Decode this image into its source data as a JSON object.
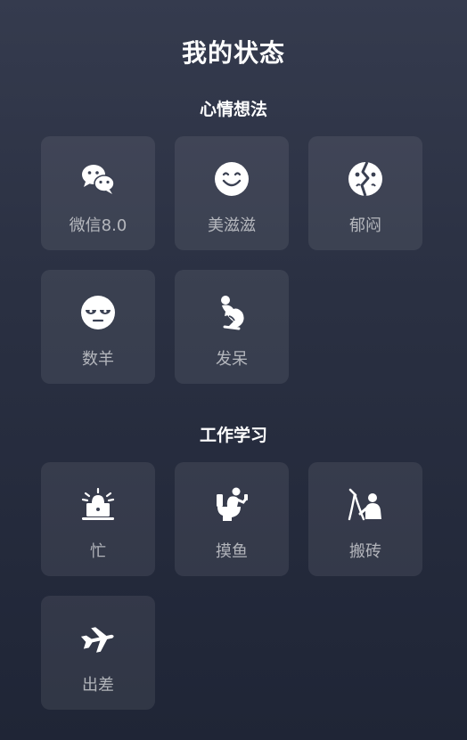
{
  "page": {
    "title": "我的状态"
  },
  "sections": [
    {
      "title": "心情想法",
      "items": [
        {
          "label": "微信8.0",
          "icon": "wechat-icon"
        },
        {
          "label": "美滋滋",
          "icon": "smile-icon"
        },
        {
          "label": "郁闷",
          "icon": "broken-face-icon"
        },
        {
          "label": "数羊",
          "icon": "sleepy-face-icon"
        },
        {
          "label": "发呆",
          "icon": "thinker-icon"
        }
      ]
    },
    {
      "title": "工作学习",
      "items": [
        {
          "label": "忙",
          "icon": "alarm-laptop-icon"
        },
        {
          "label": "摸鱼",
          "icon": "toilet-phone-icon"
        },
        {
          "label": "搬砖",
          "icon": "worker-icon"
        },
        {
          "label": "出差",
          "icon": "airplane-icon"
        }
      ]
    }
  ],
  "colors": {
    "background_top": "#353b4e",
    "background_bottom": "#1f2536",
    "tile": "#3a4052",
    "label": "#a3a6ae"
  }
}
